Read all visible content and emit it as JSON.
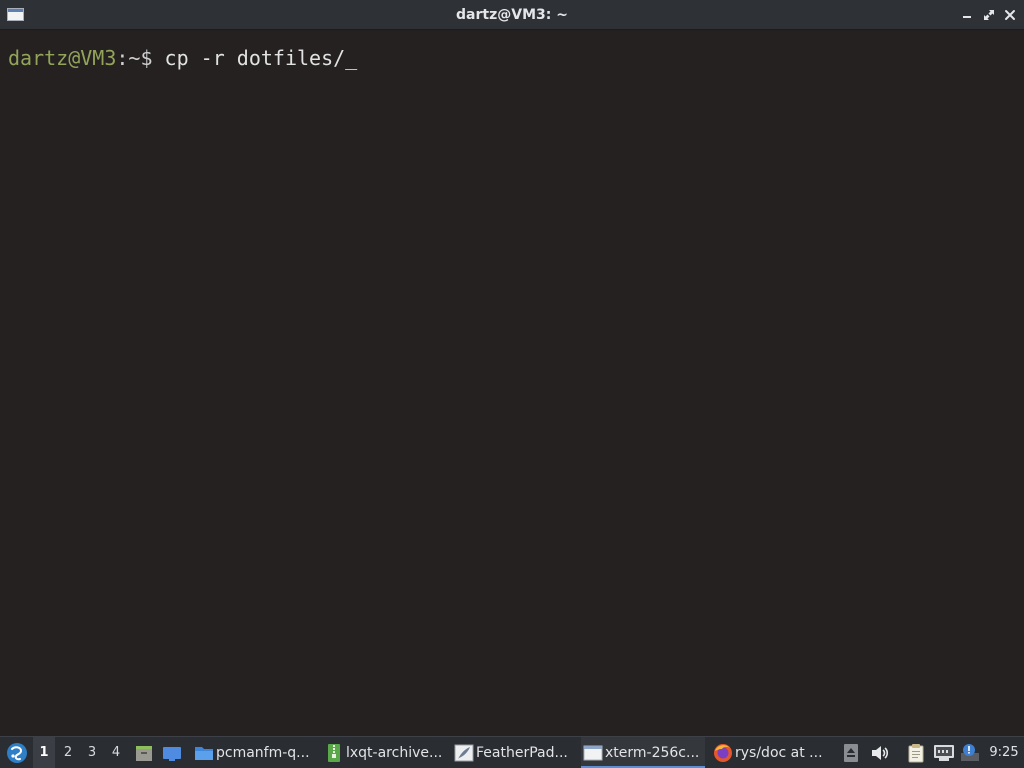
{
  "window": {
    "title": "dartz@VM3: ~",
    "icon": "terminal-window-icon"
  },
  "terminal": {
    "prompt_user_host": "dartz@VM3",
    "prompt_colon": ":",
    "prompt_path": "~",
    "prompt_symbol": "$",
    "command": " cp -r dotfiles/",
    "cursor": "_",
    "colors": {
      "background": "#242120",
      "user_host": "#93a45a",
      "text": "#e2e2e2"
    }
  },
  "taskbar": {
    "start_icon": "lxqt-start-icon",
    "workspaces": [
      "1",
      "2",
      "3",
      "4"
    ],
    "active_workspace": "1",
    "quicklaunch": [
      {
        "icon": "file-manager-icon"
      },
      {
        "icon": "show-desktop-icon"
      }
    ],
    "tasks": [
      {
        "label": "pcmanfm-q...",
        "icon": "folder-icon"
      },
      {
        "label": "lxqt-archive...",
        "icon": "archive-icon"
      },
      {
        "label": "FeatherPad...",
        "icon": "featherpad-icon"
      },
      {
        "label": "xterm-256c...",
        "icon": "terminal-icon",
        "active": true
      },
      {
        "label": "rys/doc at ...",
        "icon": "firefox-icon"
      }
    ],
    "tray": [
      {
        "icon": "eject-icon"
      },
      {
        "icon": "volume-icon"
      },
      {
        "icon": "clipboard-icon"
      },
      {
        "icon": "network-icon"
      },
      {
        "icon": "notification-icon"
      }
    ],
    "clock": "9:25",
    "accent": "#5b8fd6"
  }
}
